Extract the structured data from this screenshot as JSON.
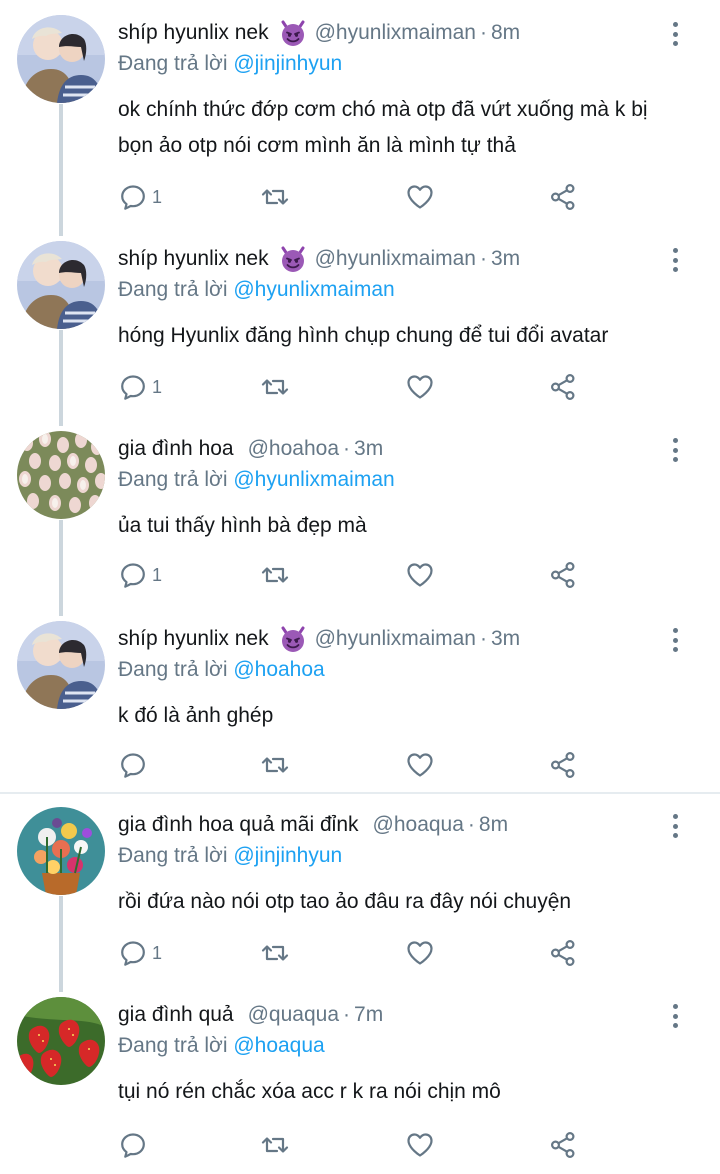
{
  "tweets": [
    {
      "name": "shíp hyunlix nek",
      "has_emoji": true,
      "emoji": "smiling-devil-emoji",
      "handle": "@hyunlixmaiman",
      "time": "8m",
      "reply_prefix": "Đang trả lời",
      "reply_to": "@jinjinhyun",
      "text": "ok chính thức đớp cơm chó mà otp đã vứt xuống mà k bị bọn ảo otp nói cơm mình ăn là mình tự thả",
      "reply_count": "1",
      "avatar": "couple-photo"
    },
    {
      "name": "shíp hyunlix nek",
      "has_emoji": true,
      "emoji": "smiling-devil-emoji",
      "handle": "@hyunlixmaiman",
      "time": "3m",
      "reply_prefix": "Đang trả lời",
      "reply_to": "@hyunlixmaiman",
      "text": "hóng Hyunlix đăng hình chụp chung để tui đổi avatar",
      "reply_count": "1",
      "avatar": "couple-photo"
    },
    {
      "name": "gia đình hoa",
      "has_emoji": false,
      "handle": "@hoahoa",
      "time": "3m",
      "reply_prefix": "Đang trả lời",
      "reply_to": "@hyunlixmaiman",
      "text": "ủa tui thấy hình bà đẹp mà",
      "reply_count": "1",
      "avatar": "tulips-photo"
    },
    {
      "name": "shíp hyunlix nek",
      "has_emoji": true,
      "emoji": "smiling-devil-emoji",
      "handle": "@hyunlixmaiman",
      "time": "3m",
      "reply_prefix": "Đang trả lời",
      "reply_to": "@hoahoa",
      "text": "k đó là ảnh ghép",
      "reply_count": "",
      "avatar": "couple-photo"
    },
    {
      "name": "gia đình hoa quả mãi đỉnk",
      "has_emoji": false,
      "handle": "@hoaqua",
      "time": "8m",
      "reply_prefix": "Đang trả lời",
      "reply_to": "@jinjinhyun",
      "text": "rồi đứa nào nói otp tao ảo đâu ra đây nói chuyện",
      "reply_count": "1",
      "avatar": "flower-bouquet-photo"
    },
    {
      "name": "gia đình quả",
      "has_emoji": false,
      "handle": "@quaqua",
      "time": "7m",
      "reply_prefix": "Đang trả lời",
      "reply_to": "@hoaqua",
      "text": "tụi nó rén chắc xóa acc r k ra nói chịn mô",
      "reply_count": "",
      "avatar": "strawberries-photo"
    }
  ],
  "dot": "·",
  "colors": {
    "text": "#14171a",
    "secondary": "#657786",
    "accent": "#1da1f2",
    "thread_line": "#ccd6dd",
    "divider": "#e6ecf0"
  }
}
